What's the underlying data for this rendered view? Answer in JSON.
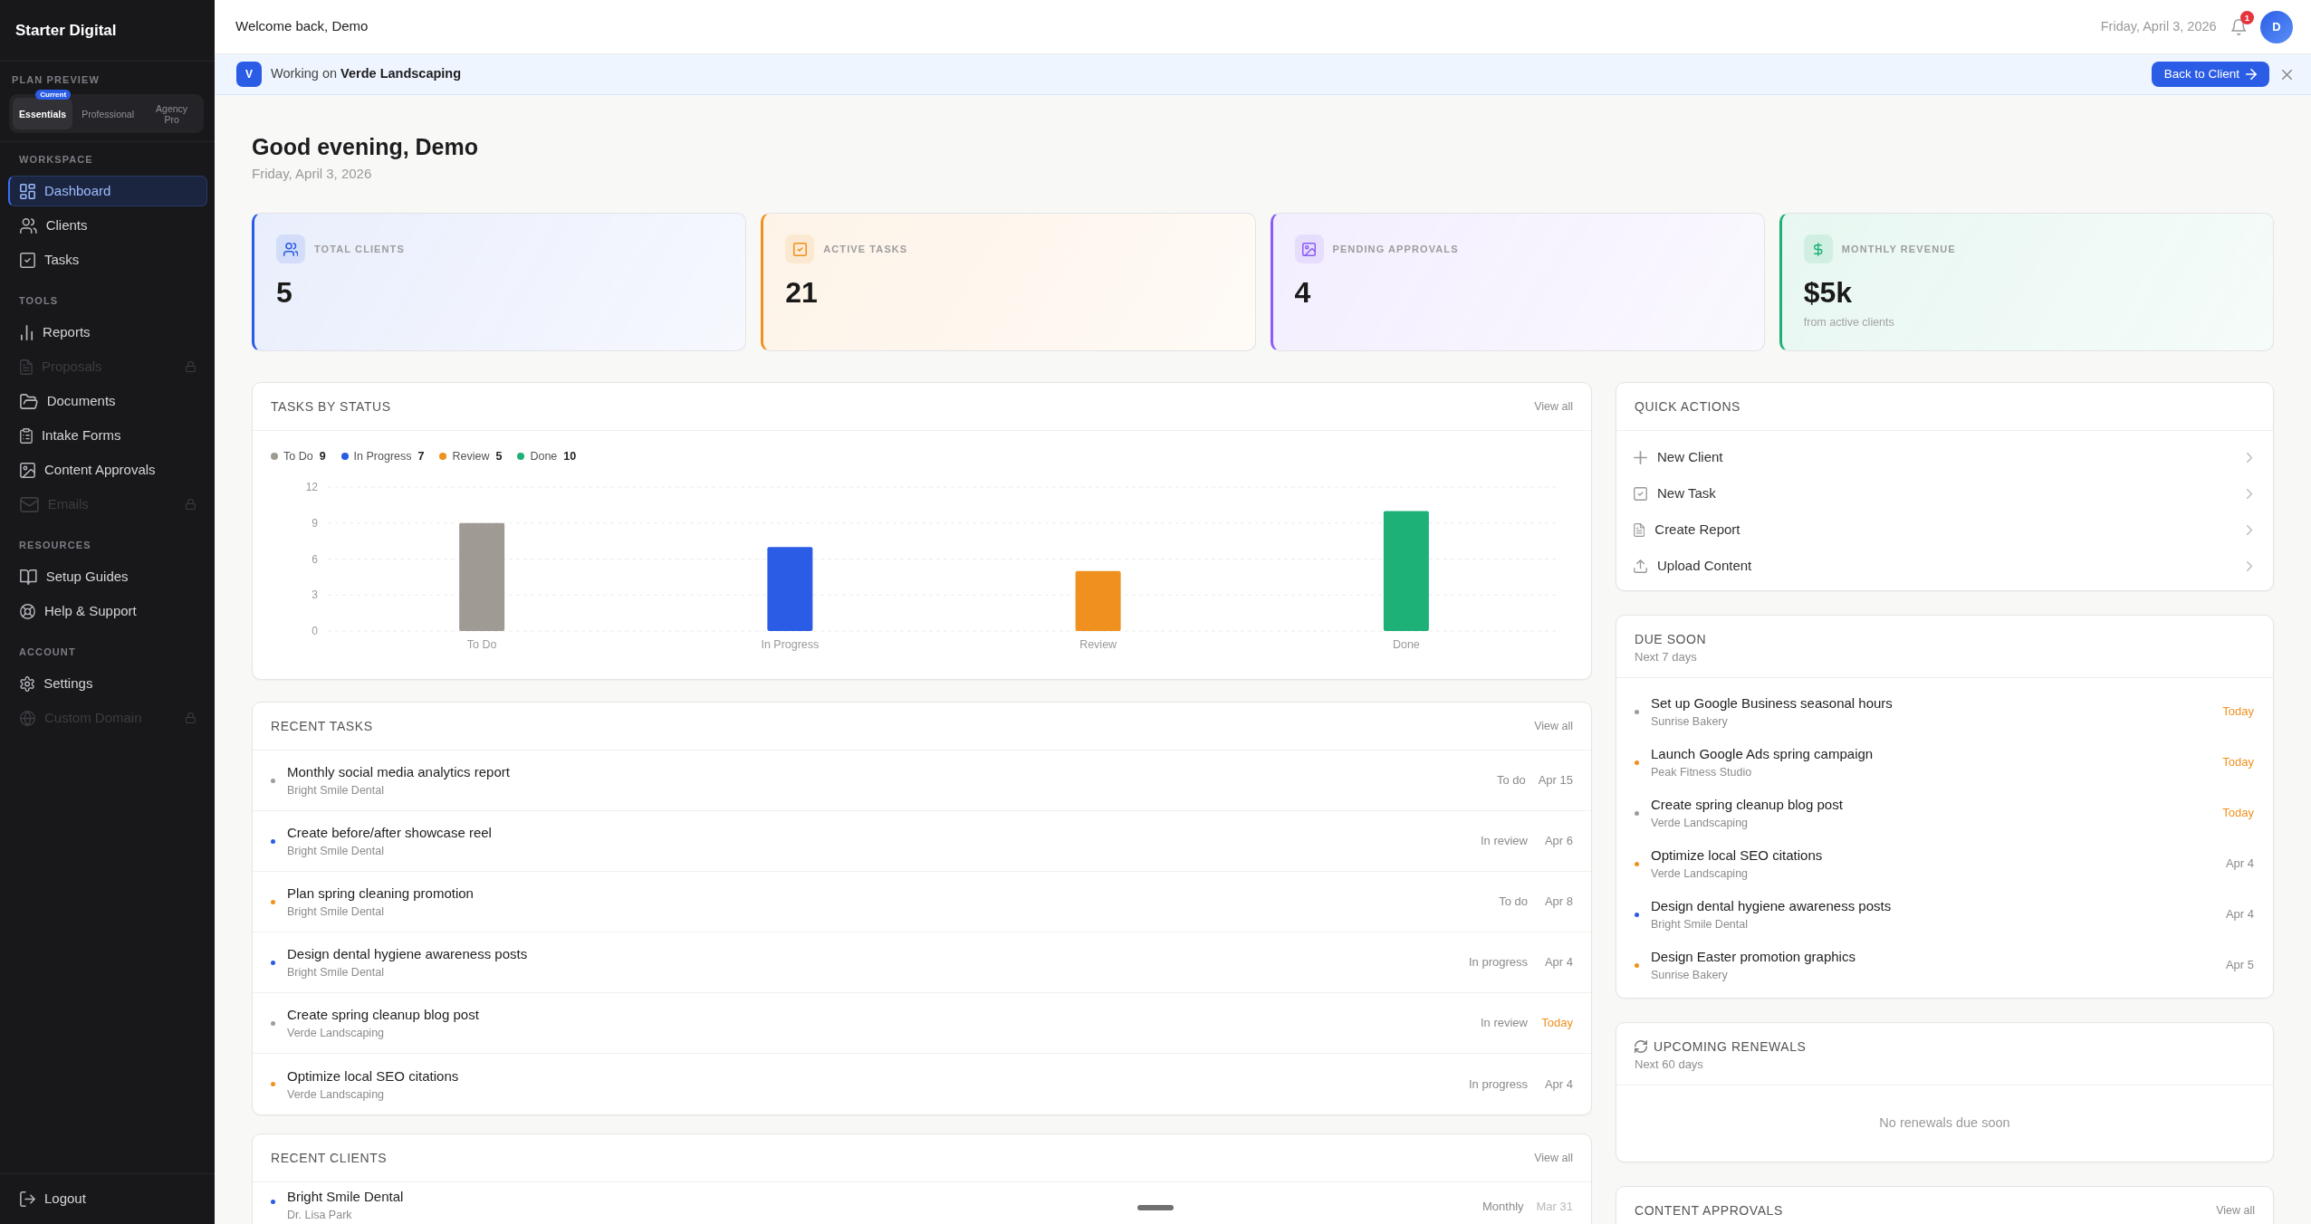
{
  "sidebar": {
    "brand": "Starter Digital",
    "plan_preview": {
      "label": "PLAN PREVIEW",
      "options": [
        {
          "label": "Essentials",
          "badge": "Current",
          "selected": true
        },
        {
          "label": "Professional",
          "selected": false
        },
        {
          "label": "Agency Pro",
          "selected": false
        }
      ]
    },
    "sections": [
      {
        "title": "WORKSPACE",
        "items": [
          {
            "label": "Dashboard",
            "selected": true,
            "disabled": false
          },
          {
            "label": "Clients",
            "selected": false,
            "disabled": false
          },
          {
            "label": "Tasks",
            "selected": false,
            "disabled": false
          }
        ]
      },
      {
        "title": "TOOLS",
        "items": [
          {
            "label": "Reports",
            "selected": false,
            "disabled": false
          },
          {
            "label": "Proposals",
            "selected": false,
            "disabled": true
          },
          {
            "label": "Documents",
            "selected": false,
            "disabled": false
          },
          {
            "label": "Intake Forms",
            "selected": false,
            "disabled": false
          },
          {
            "label": "Content Approvals",
            "selected": false,
            "disabled": false
          },
          {
            "label": "Emails",
            "selected": false,
            "disabled": true
          }
        ]
      },
      {
        "title": "RESOURCES",
        "items": [
          {
            "label": "Setup Guides",
            "selected": false,
            "disabled": false
          },
          {
            "label": "Help & Support",
            "selected": false,
            "disabled": false
          }
        ]
      },
      {
        "title": "ACCOUNT",
        "items": [
          {
            "label": "Settings",
            "selected": false,
            "disabled": false
          },
          {
            "label": "Custom Domain",
            "selected": false,
            "disabled": true
          }
        ]
      }
    ],
    "logout": "Logout"
  },
  "topbar": {
    "greeting": "Welcome back, Demo",
    "date": "Friday, April 3, 2026",
    "notification_count": "1",
    "avatar": "D"
  },
  "client_banner": {
    "avatar": "V",
    "text": "Working on **Verde Landscaping**",
    "button": "Back to Client"
  },
  "page_header": {
    "title": "Good evening, Demo",
    "date": "Friday, April 3, 2026"
  },
  "stats": [
    {
      "label": "TOTAL CLIENTS",
      "value": "5",
      "color": "#2b5ce6"
    },
    {
      "label": "ACTIVE TASKS",
      "value": "21",
      "color": "#f0901e"
    },
    {
      "label": "PENDING APPROVALS",
      "value": "4",
      "color": "#8b5cf6"
    },
    {
      "label": "MONTHLY REVENUE",
      "value": "$5k",
      "note": "from active clients",
      "color": "#1db177"
    }
  ],
  "tasks_by_status": {
    "title": "TASKS BY STATUS",
    "link": "View all",
    "legend": [
      {
        "label": "To Do",
        "count": "9",
        "color": "#a09a95"
      },
      {
        "label": "In Progress",
        "count": "7",
        "color": "#2b5ce6"
      },
      {
        "label": "Review",
        "count": "5",
        "color": "#f0901e"
      },
      {
        "label": "Done",
        "count": "10",
        "color": "#1db177"
      }
    ],
    "chart_data": {
      "type": "bar",
      "categories": [
        "To Do",
        "In Progress",
        "Review",
        "Done"
      ],
      "values": [
        9,
        7,
        5,
        10
      ],
      "ylim": [
        0,
        12
      ],
      "yticks": [
        0,
        3,
        6,
        9,
        12
      ],
      "grid": true
    }
  },
  "recent_tasks": {
    "title": "RECENT TASKS",
    "link": "View all",
    "rows": [
      {
        "title": "Monthly social media analytics report",
        "client": "Bright Smile Dental",
        "status": "To do",
        "due": "Apr 15",
        "due_today": false,
        "color": "#9c9c9c"
      },
      {
        "title": "Create before/after showcase reel",
        "client": "Bright Smile Dental",
        "status": "In review",
        "due": "Apr 6",
        "due_today": false,
        "color": "#2b5ce6"
      },
      {
        "title": "Plan spring cleaning promotion",
        "client": "Bright Smile Dental",
        "status": "To do",
        "due": "Apr 8",
        "due_today": false,
        "color": "#f0901e"
      },
      {
        "title": "Design dental hygiene awareness posts",
        "client": "Bright Smile Dental",
        "status": "In progress",
        "due": "Apr 4",
        "due_today": false,
        "color": "#2b5ce6"
      },
      {
        "title": "Create spring cleanup blog post",
        "client": "Verde Landscaping",
        "status": "In review",
        "due": "Today",
        "due_today": true,
        "color": "#9c9c9c"
      },
      {
        "title": "Optimize local SEO citations",
        "client": "Verde Landscaping",
        "status": "In progress",
        "due": "Apr 4",
        "due_today": false,
        "color": "#f0901e"
      }
    ]
  },
  "recent_clients": {
    "title": "RECENT CLIENTS",
    "link": "View all",
    "rows": [
      {
        "name": "Bright Smile Dental",
        "contact": "Dr. Lisa Park",
        "plan": "Monthly",
        "date": "Mar 31",
        "color": "#2b5ce6"
      }
    ]
  },
  "quick_actions": {
    "title": "QUICK ACTIONS",
    "items": [
      "New Client",
      "New Task",
      "Create Report",
      "Upload Content"
    ]
  },
  "due_soon": {
    "title": "DUE SOON",
    "subtitle": "Next 7 days",
    "rows": [
      {
        "title": "Set up Google Business seasonal hours",
        "client": "Sunrise Bakery",
        "due": "Today",
        "due_today": true,
        "color": "#9c9c9c"
      },
      {
        "title": "Launch Google Ads spring campaign",
        "client": "Peak Fitness Studio",
        "due": "Today",
        "due_today": true,
        "color": "#f0901e"
      },
      {
        "title": "Create spring cleanup blog post",
        "client": "Verde Landscaping",
        "due": "Today",
        "due_today": true,
        "color": "#9c9c9c"
      },
      {
        "title": "Optimize local SEO citations",
        "client": "Verde Landscaping",
        "due": "Apr 4",
        "due_today": false,
        "color": "#f0901e"
      },
      {
        "title": "Design dental hygiene awareness posts",
        "client": "Bright Smile Dental",
        "due": "Apr 4",
        "due_today": false,
        "color": "#2b5ce6"
      },
      {
        "title": "Design Easter promotion graphics",
        "client": "Sunrise Bakery",
        "due": "Apr 5",
        "due_today": false,
        "color": "#f0901e"
      }
    ]
  },
  "upcoming_renewals": {
    "title": "UPCOMING RENEWALS",
    "subtitle": "Next 60 days",
    "empty_text": "No renewals due soon"
  },
  "content_approvals": {
    "title": "CONTENT APPROVALS",
    "link": "View all"
  }
}
